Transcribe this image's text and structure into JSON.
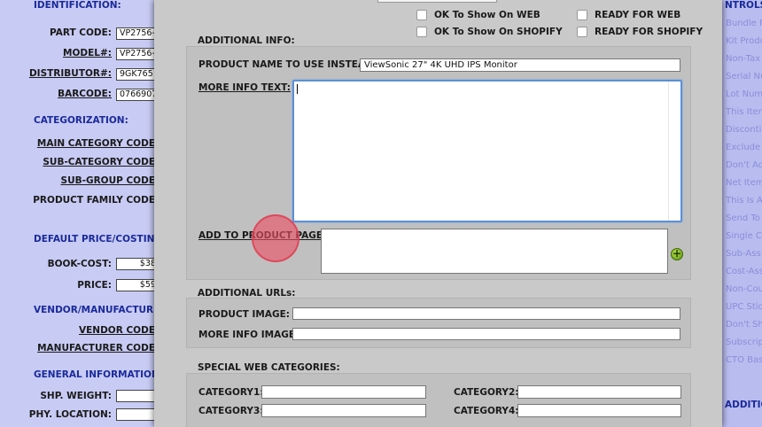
{
  "left": {
    "identification_title": "IDENTIFICATION:",
    "part_code_label": "PART CODE:",
    "part_code_value": "VP2756-",
    "model_label": "MODEL#:",
    "model_value": "VP2756-",
    "distributor_label": "DISTRIBUTOR#:",
    "distributor_value": "9GK765",
    "barcode_label": "BARCODE:",
    "barcode_value": "0766907",
    "categorization_title": "CATEGORIZATION:",
    "main_category_label": "MAIN CATEGORY CODE",
    "sub_category_label": "SUB-CATEGORY CODE",
    "sub_group_label": "SUB-GROUP CODE",
    "product_family_label": "PRODUCT FAMILY CODE",
    "default_price_title": "DEFAULT PRICE/COSTING:",
    "book_cost_label": "BOOK-COST:",
    "book_cost_value": "$38",
    "price_label": "PRICE:",
    "price_value": "$59",
    "vendor_title": "VENDOR/MANUFACTURER",
    "vendor_code_label": "VENDOR CODE",
    "manufacturer_code_label": "MANUFACTURER CODE",
    "general_info_title": "GENERAL INFORMATION:",
    "shp_weight_label": "SHP. WEIGHT:",
    "phy_location_label": "PHY. LOCATION:"
  },
  "right": {
    "controls_title": "NTROLS",
    "items": [
      "Bundle P",
      "Kit Produ",
      "Non-Tax",
      "Serial Nu",
      "Lot Numb",
      "This Item",
      "Discontin",
      "Exclude",
      "Don't Ad",
      "Net Item",
      "This Is A",
      "Send To",
      "Single C",
      "Sub-Ass",
      "Cost-Ass",
      "Non-Cou",
      "UPC Stic",
      "Don't Sh",
      "Subscrip",
      "CTO Bas"
    ],
    "addition_title": "ADDITIO"
  },
  "dialog": {
    "ok_web_label": "OK To Show On WEB",
    "ok_shopify_label": "OK To Show On SHOPIFY",
    "ready_web_label": "READY FOR WEB",
    "ready_shopify_label": "READY FOR SHOPIFY",
    "additional_info_title": "ADDITIONAL INFO:",
    "product_name_label": "PRODUCT NAME TO USE INSTEAD:",
    "product_name_value": "ViewSonic 27\" 4K UHD IPS Monitor",
    "more_info_label": "MORE INFO TEXT:",
    "add_to_page_label": "ADD TO PRODUCT PAGE:",
    "add_button_symbol": "+",
    "additional_urls_title": "ADDITIONAL URLs:",
    "product_image_label": "PRODUCT IMAGE:",
    "more_info_image_label": "MORE INFO IMAGE:",
    "special_web_title": "SPECIAL WEB CATEGORIES:",
    "category1_label": "CATEGORY1:",
    "category2_label": "CATEGORY2:",
    "category3_label": "CATEGORY3:",
    "category4_label": "CATEGORY4:"
  }
}
